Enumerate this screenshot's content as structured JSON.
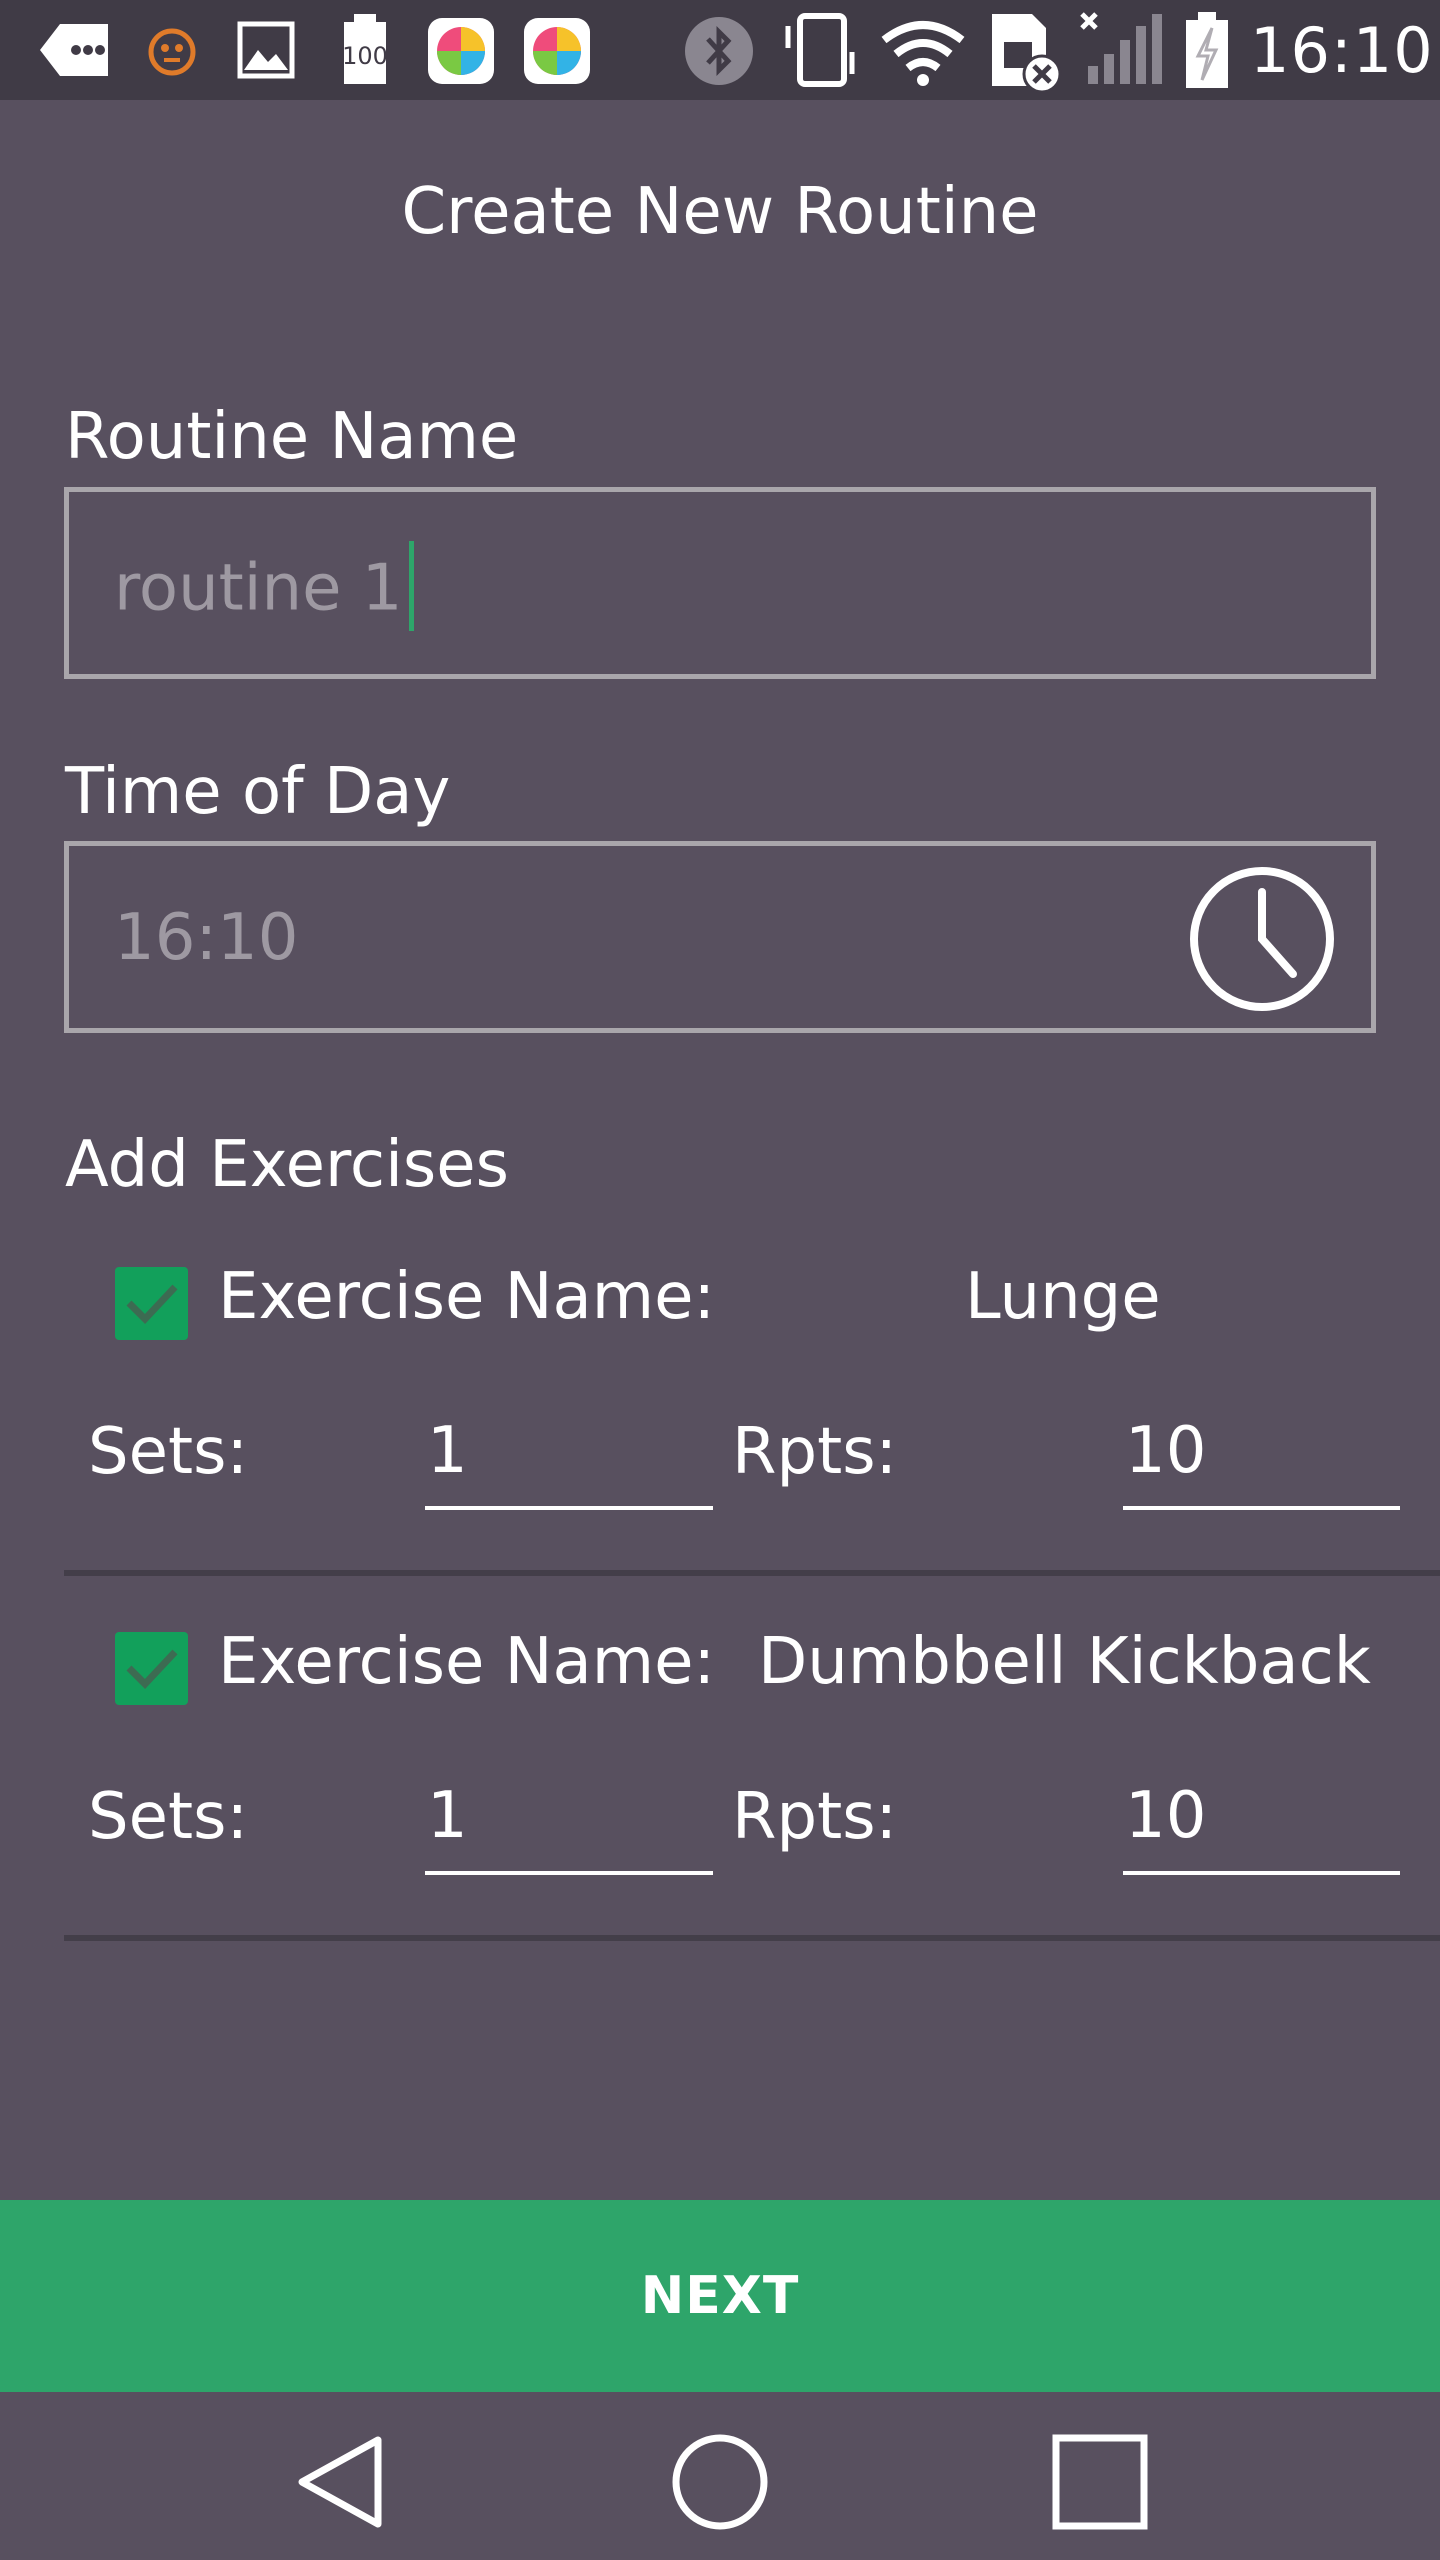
{
  "status_bar": {
    "time": "16:10",
    "icons": [
      "back-arrow-icon",
      "face-icon",
      "image-icon",
      "battery-100-icon",
      "colorful-app-icon",
      "colorful-app-icon",
      "bluetooth-icon",
      "vibrate-icon",
      "wifi-icon",
      "sim-error-icon",
      "signal-icon",
      "battery-charging-icon"
    ]
  },
  "header": {
    "title": "Create New Routine"
  },
  "form": {
    "routine_name_label": "Routine Name",
    "routine_name_value": "routine 1",
    "time_label": "Time of Day",
    "time_value": "16:10",
    "add_exercises_label": "Add Exercises"
  },
  "exercises": [
    {
      "checked": true,
      "name_label": "Exercise Name:",
      "name": "Lunge",
      "sets_label": "Sets:",
      "sets": "1",
      "reps_label": "Rpts:",
      "reps": "10"
    },
    {
      "checked": true,
      "name_label": "Exercise Name:",
      "name": "Dumbbell Kickback",
      "sets_label": "Sets:",
      "sets": "1",
      "reps_label": "Rpts:",
      "reps": "10"
    }
  ],
  "actions": {
    "next_label": "NEXT"
  },
  "nav": {
    "icons": [
      "back-triangle-icon",
      "home-circle-icon",
      "recents-square-icon"
    ]
  },
  "colors": {
    "background": "#58505f",
    "status_bar": "#403b46",
    "accent": "#2ea56a",
    "checkbox": "#12a05b",
    "field_border": "#a9a6ab",
    "placeholder_text": "#9e99a2"
  }
}
